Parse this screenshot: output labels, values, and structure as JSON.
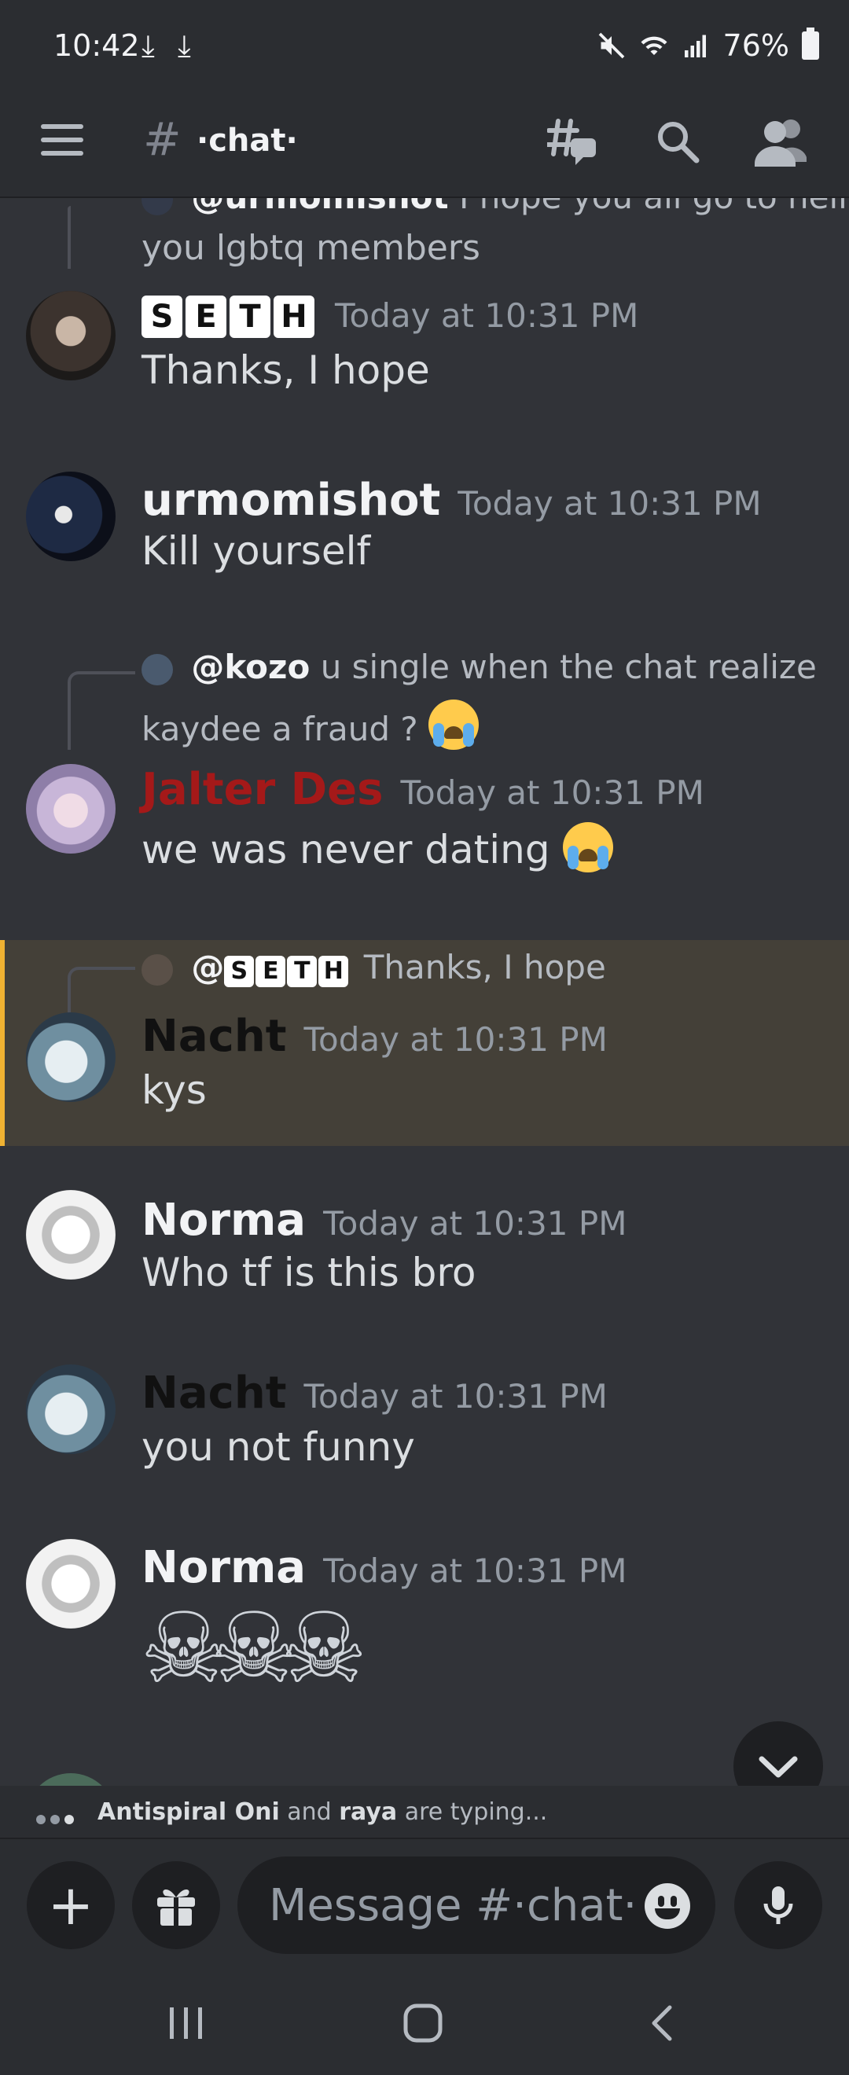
{
  "status_bar": {
    "time": "10:42",
    "battery": "76%"
  },
  "header": {
    "hash_symbol": "#",
    "channel_name": "·chat·"
  },
  "messages": [
    {
      "reply": {
        "mention": "@urmomishot",
        "text": "I hope you all go to hell",
        "continuation": "you lgbtq members"
      }
    },
    {
      "username_letters": [
        "S",
        "E",
        "T",
        "H"
      ],
      "timestamp": "Today at 10:31 PM",
      "text": "Thanks, I hope"
    },
    {
      "username": "urmomishot",
      "timestamp": "Today at 10:31 PM",
      "text": "Kill yourself"
    },
    {
      "reply": {
        "mention": "@kozo",
        "text": "u single when the chat realize",
        "continuation": "kaydee a fraud ?"
      },
      "username": "Jalter Des",
      "username_color": "#a41919",
      "timestamp": "Today at 10:31 PM",
      "text": "we was never dating"
    },
    {
      "reply": {
        "mention": "@",
        "mention_letters": [
          "S",
          "E",
          "T",
          "H"
        ],
        "text": "Thanks, I hope"
      },
      "username": "Nacht",
      "username_color": "#111111",
      "timestamp": "Today at 10:31 PM",
      "text": "kys",
      "highlight_color": "#f0b232"
    },
    {
      "username": "Norma",
      "timestamp": "Today at 10:31 PM",
      "text": "Who tf is this bro"
    },
    {
      "username": "Nacht",
      "username_color": "#111111",
      "timestamp": "Today at 10:31 PM",
      "text": "you not funny"
    },
    {
      "username": "Norma",
      "timestamp": "Today at 10:31 PM",
      "emoji": "☠☠☠"
    }
  ],
  "typing": {
    "user1": "Antispiral Oni",
    "joiner": " and ",
    "user2": "raya",
    "suffix": " are typing..."
  },
  "composer": {
    "placeholder": "Message #·chat·"
  },
  "icons": {
    "menu": "hamburger-icon",
    "threads": "threads-icon",
    "search": "search-icon",
    "members": "members-icon",
    "attach": "plus-icon",
    "gift": "gift-icon",
    "emoji": "smiley-icon",
    "mic": "microphone-icon",
    "jump": "chevron-down-icon"
  },
  "colors": {
    "background": "#313338",
    "header": "#2b2d31",
    "mention_highlight": "#f0b232"
  }
}
